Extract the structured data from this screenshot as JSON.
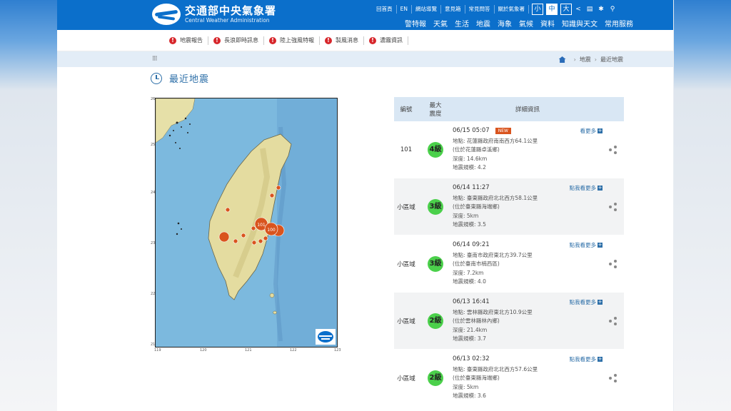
{
  "header": {
    "title_zh": "交通部中央氣象署",
    "title_en": "Central Weather Administration",
    "top_links": [
      "回首頁",
      "EN",
      "網站導覽",
      "意見箱",
      "常見問答",
      "關於氣象署"
    ],
    "font_sizes": [
      "小",
      "中",
      "大"
    ],
    "nav": [
      "警特報",
      "天氣",
      "生活",
      "地震",
      "海象",
      "氣候",
      "資料",
      "知識與天文",
      "常用服務"
    ]
  },
  "alerts": [
    "地震報告",
    "長浪即時訊息",
    "陸上強風特報",
    "製風消息",
    "濃霧資訊"
  ],
  "breadcrumb": {
    "items": [
      "地震",
      "最近地震"
    ]
  },
  "page_title": "最近地震",
  "map": {
    "lat_ticks": [
      "26",
      "25",
      "24",
      "23",
      "22",
      "21"
    ],
    "lon_ticks": [
      "119",
      "120",
      "121",
      "122",
      "123"
    ],
    "markers": [
      "101",
      "100"
    ]
  },
  "table": {
    "headers": {
      "no": "編號",
      "mag": "最大\n震度",
      "detail": "詳細資訊"
    },
    "new_label": "NEW",
    "rows": [
      {
        "no": "101",
        "intensity": "4級",
        "time": "06/15 05:07",
        "is_new": true,
        "more": "看更多",
        "loc": "地點: 花蓮縣政府南南西方64.1公里",
        "area": "(位於花蓮縣卓溪鄉)",
        "depth": "深度: 14.6km",
        "scale": "地震規模: 4.2"
      },
      {
        "no": "小區域",
        "intensity": "3級",
        "time": "06/14 11:27",
        "is_new": false,
        "more": "點我看更多",
        "loc": "地點: 臺東縣政府北北西方58.1公里",
        "area": "(位於臺東縣海端鄉)",
        "depth": "深度: 5km",
        "scale": "地震規模: 3.5"
      },
      {
        "no": "小區域",
        "intensity": "3級",
        "time": "06/14 09:21",
        "is_new": false,
        "more": "點我看更多",
        "loc": "地點: 臺南市政府東北方39.7公里",
        "area": "(位於臺南市楠西區)",
        "depth": "深度: 7.2km",
        "scale": "地震規模: 4.0"
      },
      {
        "no": "小區域",
        "intensity": "2級",
        "time": "06/13 16:41",
        "is_new": false,
        "more": "點我看更多",
        "loc": "地點: 雲林縣政府東北方10.9公里",
        "area": "(位於雲林縣林內鄉)",
        "depth": "深度: 21.4km",
        "scale": "地震規模: 3.7"
      },
      {
        "no": "小區域",
        "intensity": "2級",
        "time": "06/13 02:32",
        "is_new": false,
        "more": "點我看更多",
        "loc": "地點: 臺東縣政府北北西方57.6公里",
        "area": "(位於臺東縣海端鄉)",
        "depth": "深度: 5km",
        "scale": "地震規模: 3.6"
      }
    ]
  },
  "colors": {
    "brand": "#0b6fcb",
    "accent_text": "#2d6fa8",
    "intensity_green": "#4bd04b",
    "marker_red": "#d9541e"
  }
}
